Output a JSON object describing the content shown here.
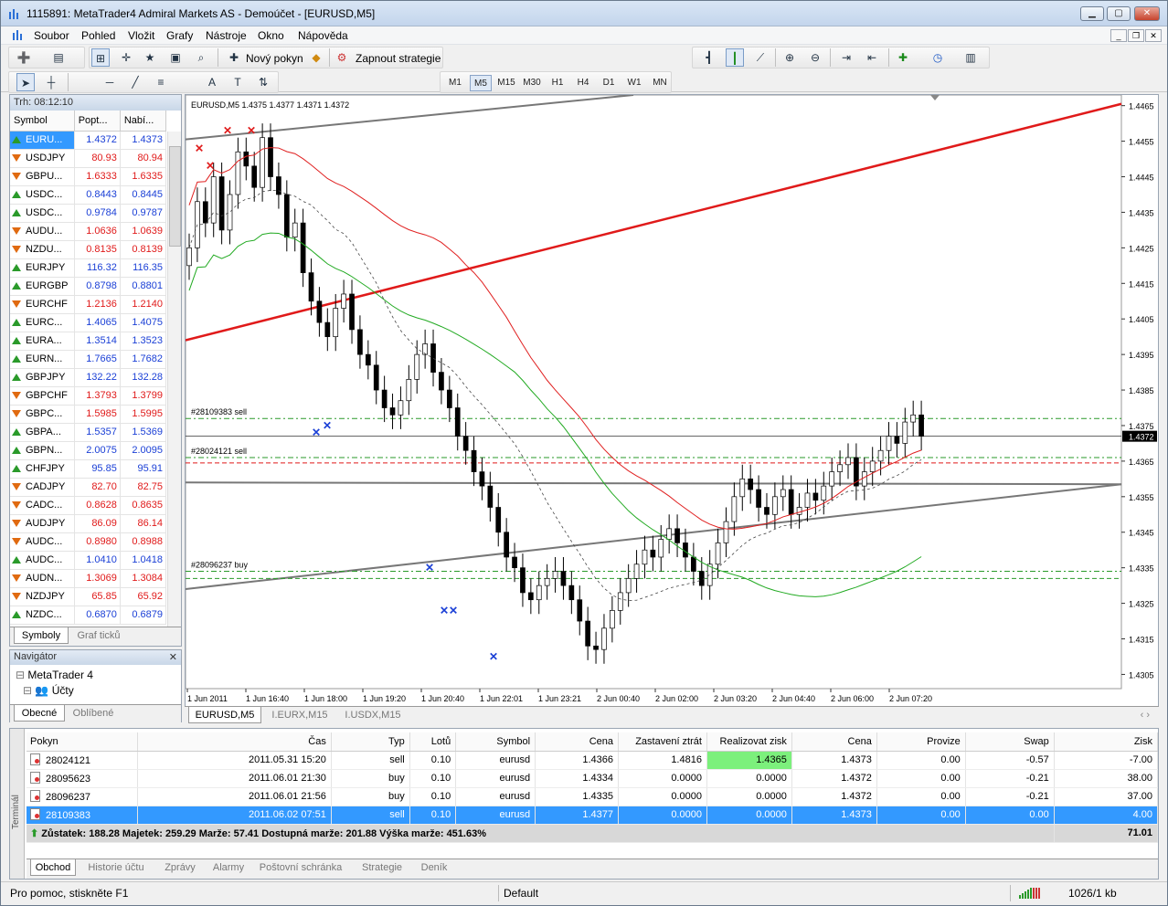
{
  "window": {
    "title": "1115891: MetaTrader4 Admiral Markets AS - Demoúčet - [EURUSD,M5]"
  },
  "menu": [
    "Soubor",
    "Pohled",
    "Vložit",
    "Grafy",
    "Nástroje",
    "Okno",
    "Nápověda"
  ],
  "toolbar": {
    "new_order": "Nový pokyn",
    "autotrading": "Zapnout strategie",
    "timeframes": [
      "M1",
      "M5",
      "M15",
      "M30",
      "H1",
      "H4",
      "D1",
      "W1",
      "MN"
    ],
    "active_timeframe": "M5"
  },
  "market_watch": {
    "header": "Trh: 08:12:10",
    "columns": [
      "Symbol",
      "Popt...",
      "Nabí..."
    ],
    "rows": [
      {
        "symbol": "EURU...",
        "bid": "1.4372",
        "ask": "1.4373",
        "dir": "up",
        "sel": true
      },
      {
        "symbol": "USDJPY",
        "bid": "80.93",
        "ask": "80.94",
        "dir": "down"
      },
      {
        "symbol": "GBPU...",
        "bid": "1.6333",
        "ask": "1.6335",
        "dir": "down"
      },
      {
        "symbol": "USDC...",
        "bid": "0.8443",
        "ask": "0.8445",
        "dir": "up"
      },
      {
        "symbol": "USDC...",
        "bid": "0.9784",
        "ask": "0.9787",
        "dir": "up"
      },
      {
        "symbol": "AUDU...",
        "bid": "1.0636",
        "ask": "1.0639",
        "dir": "down"
      },
      {
        "symbol": "NZDU...",
        "bid": "0.8135",
        "ask": "0.8139",
        "dir": "down"
      },
      {
        "symbol": "EURJPY",
        "bid": "116.32",
        "ask": "116.35",
        "dir": "up"
      },
      {
        "symbol": "EURGBP",
        "bid": "0.8798",
        "ask": "0.8801",
        "dir": "up"
      },
      {
        "symbol": "EURCHF",
        "bid": "1.2136",
        "ask": "1.2140",
        "dir": "down"
      },
      {
        "symbol": "EURC...",
        "bid": "1.4065",
        "ask": "1.4075",
        "dir": "up"
      },
      {
        "symbol": "EURA...",
        "bid": "1.3514",
        "ask": "1.3523",
        "dir": "up"
      },
      {
        "symbol": "EURN...",
        "bid": "1.7665",
        "ask": "1.7682",
        "dir": "up"
      },
      {
        "symbol": "GBPJPY",
        "bid": "132.22",
        "ask": "132.28",
        "dir": "up"
      },
      {
        "symbol": "GBPCHF",
        "bid": "1.3793",
        "ask": "1.3799",
        "dir": "down"
      },
      {
        "symbol": "GBPC...",
        "bid": "1.5985",
        "ask": "1.5995",
        "dir": "down"
      },
      {
        "symbol": "GBPA...",
        "bid": "1.5357",
        "ask": "1.5369",
        "dir": "up"
      },
      {
        "symbol": "GBPN...",
        "bid": "2.0075",
        "ask": "2.0095",
        "dir": "up"
      },
      {
        "symbol": "CHFJPY",
        "bid": "95.85",
        "ask": "95.91",
        "dir": "up"
      },
      {
        "symbol": "CADJPY",
        "bid": "82.70",
        "ask": "82.75",
        "dir": "down"
      },
      {
        "symbol": "CADC...",
        "bid": "0.8628",
        "ask": "0.8635",
        "dir": "down"
      },
      {
        "symbol": "AUDJPY",
        "bid": "86.09",
        "ask": "86.14",
        "dir": "down"
      },
      {
        "symbol": "AUDC...",
        "bid": "0.8980",
        "ask": "0.8988",
        "dir": "down"
      },
      {
        "symbol": "AUDC...",
        "bid": "1.0410",
        "ask": "1.0418",
        "dir": "up"
      },
      {
        "symbol": "AUDN...",
        "bid": "1.3069",
        "ask": "1.3084",
        "dir": "down"
      },
      {
        "symbol": "NZDJPY",
        "bid": "65.85",
        "ask": "65.92",
        "dir": "down"
      },
      {
        "symbol": "NZDC...",
        "bid": "0.6870",
        "ask": "0.6879",
        "dir": "up"
      }
    ],
    "tabs": [
      "Symboly",
      "Graf ticků"
    ]
  },
  "navigator": {
    "header": "Navigátor",
    "root": "MetaTrader 4",
    "accounts": "Účty",
    "tabs": [
      "Obecné",
      "Oblíbené"
    ]
  },
  "chart": {
    "info": "EURUSD,M5  1.4375 1.4377 1.4371 1.4372",
    "tabs": [
      "EURUSD,M5",
      "I.EURX,M15",
      "I.USDX,M15"
    ],
    "order_labels": [
      "#28109383 sell",
      "#28024121 sell",
      "#28096237 buy"
    ],
    "current_price": "1.4372"
  },
  "chart_data": {
    "type": "candlestick",
    "symbol": "EURUSD",
    "timeframe": "M5",
    "y_ticks": [
      "1.4465",
      "1.4455",
      "1.4445",
      "1.4435",
      "1.4425",
      "1.4415",
      "1.4405",
      "1.4395",
      "1.4385",
      "1.4375",
      "1.4365",
      "1.4355",
      "1.4345",
      "1.4335",
      "1.4325",
      "1.4315",
      "1.4305"
    ],
    "x_ticks": [
      "1 Jun 2011",
      "1 Jun 16:40",
      "1 Jun 18:00",
      "1 Jun 19:20",
      "1 Jun 20:40",
      "1 Jun 22:01",
      "1 Jun 23:21",
      "2 Jun 00:40",
      "2 Jun 02:00",
      "2 Jun 03:20",
      "2 Jun 04:40",
      "2 Jun 06:00",
      "2 Jun 07:20"
    ],
    "ylim": [
      1.4301,
      1.4468
    ],
    "close": [
      1.4425,
      1.4438,
      1.4432,
      1.4445,
      1.443,
      1.444,
      1.4452,
      1.4448,
      1.4442,
      1.4456,
      1.4445,
      1.444,
      1.4428,
      1.4432,
      1.4418,
      1.441,
      1.4404,
      1.44,
      1.4408,
      1.4412,
      1.4402,
      1.4395,
      1.4392,
      1.4385,
      1.438,
      1.4378,
      1.4382,
      1.4388,
      1.4395,
      1.4398,
      1.439,
      1.4385,
      1.438,
      1.4372,
      1.4368,
      1.4362,
      1.4358,
      1.4352,
      1.4345,
      1.4338,
      1.4335,
      1.4328,
      1.4326,
      1.433,
      1.4332,
      1.4334,
      1.433,
      1.4326,
      1.432,
      1.4313,
      1.4312,
      1.4318,
      1.4323,
      1.4328,
      1.4332,
      1.4336,
      1.434,
      1.4338,
      1.4343,
      1.4346,
      1.4342,
      1.4338,
      1.4334,
      1.433,
      1.4336,
      1.4342,
      1.4348,
      1.4355,
      1.436,
      1.4357,
      1.4352,
      1.435,
      1.4355,
      1.4357,
      1.435,
      1.4352,
      1.4356,
      1.4354,
      1.4358,
      1.4362,
      1.4364,
      1.4366,
      1.4358,
      1.4362,
      1.4365,
      1.4368,
      1.4372,
      1.437,
      1.4376,
      1.4378,
      1.4372
    ],
    "moving_averages": [
      {
        "color": "#e02020"
      },
      {
        "color": "#22aa22"
      },
      {
        "color": "#444444",
        "style": "dashed"
      }
    ],
    "horizontal_levels": [
      {
        "label": "#28109383 sell",
        "price": 1.4377
      },
      {
        "label": "#28024121 sell",
        "price": 1.4366
      },
      {
        "label": "#28096237 buy",
        "price": 1.4334
      }
    ]
  },
  "terminal": {
    "label": "Terminál",
    "columns": [
      "Pokyn",
      "Čas",
      "Typ",
      "Lotů",
      "Symbol",
      "Cena",
      "Zastavení ztrát",
      "Realizovat zisk",
      "Cena",
      "Provize",
      "Swap",
      "Zisk"
    ],
    "rows": [
      {
        "order": "28024121",
        "time": "2011.05.31 15:20",
        "type": "sell",
        "lots": "0.10",
        "symbol": "eurusd",
        "price": "1.4366",
        "sl": "1.4816",
        "tp": "1.4365",
        "cur": "1.4373",
        "comm": "0.00",
        "swap": "-0.57",
        "profit": "-7.00"
      },
      {
        "order": "28095623",
        "time": "2011.06.01 21:30",
        "type": "buy",
        "lots": "0.10",
        "symbol": "eurusd",
        "price": "1.4334",
        "sl": "0.0000",
        "tp": "0.0000",
        "cur": "1.4372",
        "comm": "0.00",
        "swap": "-0.21",
        "profit": "38.00"
      },
      {
        "order": "28096237",
        "time": "2011.06.01 21:56",
        "type": "buy",
        "lots": "0.10",
        "symbol": "eurusd",
        "price": "1.4335",
        "sl": "0.0000",
        "tp": "0.0000",
        "cur": "1.4372",
        "comm": "0.00",
        "swap": "-0.21",
        "profit": "37.00"
      },
      {
        "order": "28109383",
        "time": "2011.06.02 07:51",
        "type": "sell",
        "lots": "0.10",
        "symbol": "eurusd",
        "price": "1.4377",
        "sl": "0.0000",
        "tp": "0.0000",
        "cur": "1.4373",
        "comm": "0.00",
        "swap": "0.00",
        "profit": "4.00"
      }
    ],
    "summary": "Zůstatek: 188.28  Majetek: 259.29  Marže: 57.41  Dostupná marže: 201.88  Výška marže: 451.63%",
    "summary_profit": "71.01",
    "tabs": [
      "Obchod",
      "Historie účtu",
      "Zprávy",
      "Alarmy",
      "Poštovní schránka",
      "Strategie",
      "Deník"
    ]
  },
  "status": {
    "help": "Pro pomoc, stiskněte F1",
    "profile": "Default",
    "traffic": "1026/1 kb"
  }
}
